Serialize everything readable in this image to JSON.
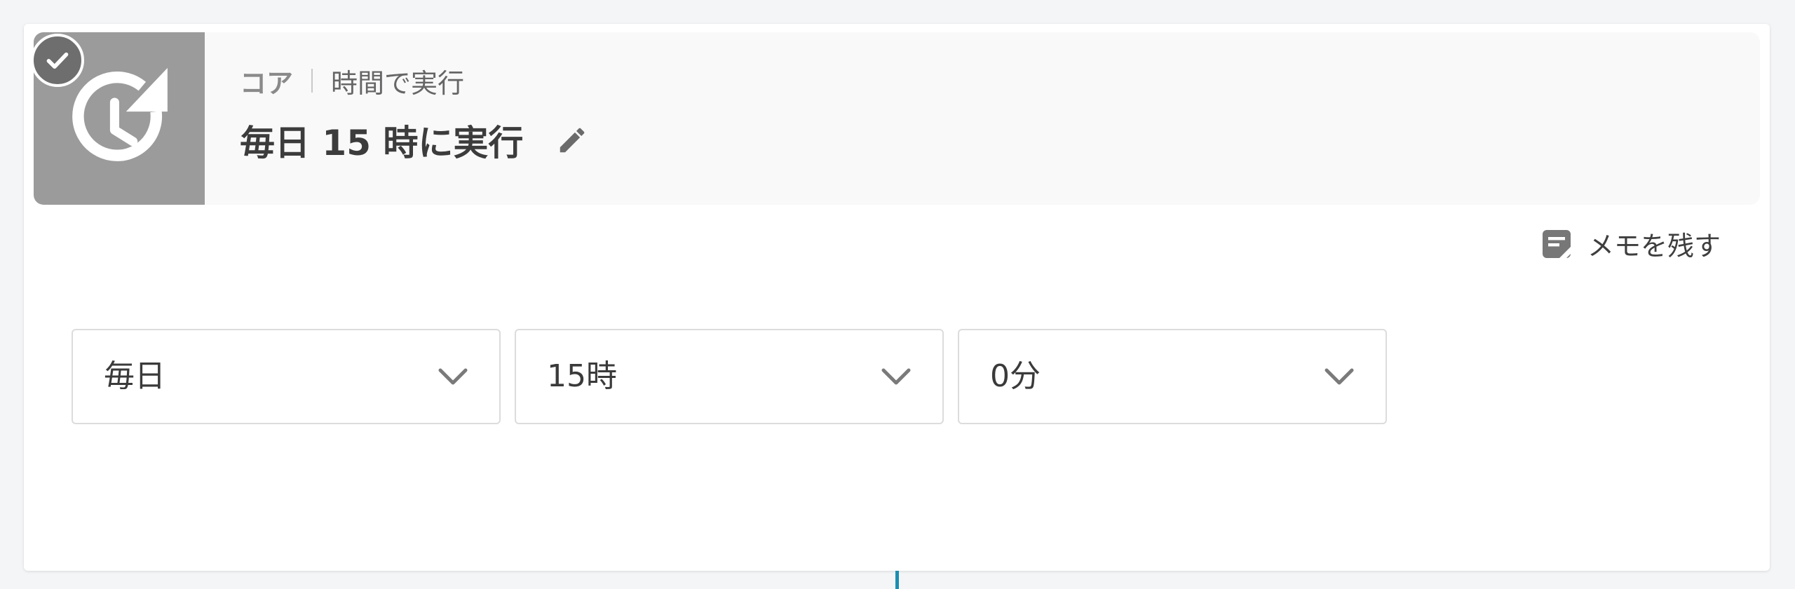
{
  "step": {
    "status_icon": "check-icon",
    "trigger_icon": "clock-refresh-icon",
    "category": "コア",
    "type": "時間で実行",
    "title": "毎日 15 時に実行",
    "edit_icon": "pencil-icon"
  },
  "memo": {
    "icon": "memo-icon",
    "label": "メモを残す"
  },
  "schedule": {
    "frequency": {
      "value": "毎日"
    },
    "hour": {
      "value": "15時"
    },
    "minute": {
      "value": "0分"
    }
  },
  "colors": {
    "icon_gray": "#9b9b9b",
    "badge_gray": "#6e6e6e",
    "connector": "#1a8fb0"
  }
}
